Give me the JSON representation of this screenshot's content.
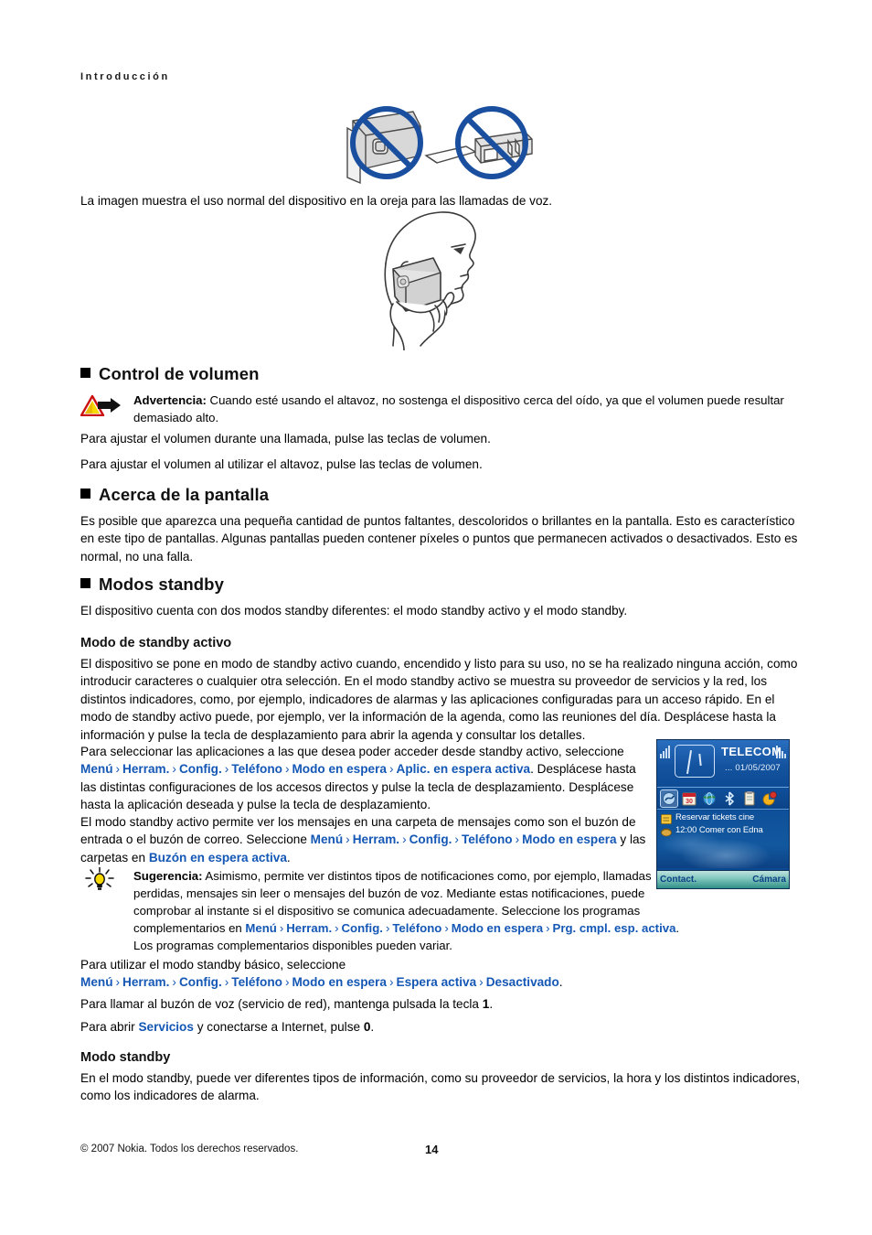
{
  "running_head": "Introducción",
  "figures": {
    "prohibition_caption": "La imagen muestra el uso normal del dispositivo en la oreja para las llamadas de voz.",
    "icon_no_touch_back": "prohibition-sign",
    "icon_no_touch_antenna": "prohibition-sign",
    "icon_head_phone": "head-with-phone-illustration"
  },
  "sections": {
    "volume": {
      "heading": "Control de volumen",
      "warning": {
        "label": "Advertencia:",
        "text": " Cuando esté usando el altavoz, no sostenga el dispositivo cerca del oído, ya que el volumen puede resultar demasiado alto.",
        "icon": "warning-triangle-icon"
      },
      "p1": "Para ajustar el volumen durante una llamada, pulse las teclas de volumen.",
      "p2": "Para ajustar el volumen al utilizar el altavoz, pulse las teclas de volumen."
    },
    "display": {
      "heading": "Acerca de la pantalla",
      "p1": "Es posible que aparezca una pequeña cantidad de puntos faltantes, descoloridos o brillantes en la pantalla. Esto es característico en este tipo de pantallas. Algunas pantallas pueden contener píxeles o puntos que permanecen activados o desactivados. Esto es normal, no una falla."
    },
    "standby": {
      "heading": "Modos standby",
      "intro": "El dispositivo cuenta con dos modos standby diferentes: el modo standby activo y el modo standby.",
      "active": {
        "heading": "Modo de standby activo",
        "p1": "El dispositivo se pone en modo de standby activo cuando, encendido y listo para su uso, no se ha realizado ninguna acción, como introducir caracteres o cualquier otra selección. En el modo standby activo se muestra su proveedor de servicios y la red, los distintos indicadores, como, por ejemplo, indicadores de alarmas y las aplicaciones configuradas para un acceso rápido. En el modo de standby activo puede, por ejemplo, ver la información de la agenda, como las reuniones del día. Desplácese hasta la información y pulse la tecla de desplazamiento para abrir la agenda y consultar los detalles.",
        "p2_pre": "Para seleccionar las aplicaciones a las que desea poder acceder desde standby activo, seleccione ",
        "p2_path": [
          "Menú",
          "Herram.",
          "Config.",
          "Teléfono",
          "Modo en espera",
          "Aplic. en espera activa"
        ],
        "p2_post": ". Desplácese hasta las distintas configuraciones de los accesos directos y pulse la tecla de desplazamiento. Desplácese hasta la aplicación deseada y pulse la tecla de desplazamiento.",
        "p3_pre": "El modo standby activo permite ver los mensajes en una carpeta de mensajes como son el buzón de entrada o el buzón de correo. Seleccione ",
        "p3_path": [
          "Menú",
          "Herram.",
          "Config.",
          "Teléfono",
          "Modo en espera"
        ],
        "p3_mid": " y las carpetas en ",
        "p3_link": "Buzón en espera activa",
        "p3_post": "."
      },
      "tip": {
        "icon": "lightbulb-tip-icon",
        "label": "Sugerencia:",
        "text": " Asimismo, permite ver distintos tipos de notificaciones como, por ejemplo, llamadas perdidas, mensajes sin leer o mensajes del buzón de voz. Mediante estas notificaciones, puede comprobar al instante si el dispositivo se comunica adecuadamente. Seleccione los programas complementarios en ",
        "path": [
          "Menú",
          "Herram.",
          "Config.",
          "Teléfono",
          "Modo en espera",
          "Prg. cmpl. esp. activa"
        ],
        "post": ". Los programas complementarios disponibles pueden variar."
      },
      "basic_pre": "Para utilizar el modo standby básico, seleccione ",
      "basic_path": [
        "Menú",
        "Herram.",
        "Config.",
        "Teléfono",
        "Modo en espera",
        "Espera activa",
        "Desactivado"
      ],
      "basic_post": ".",
      "voicemail_pre": "Para llamar al buzón de voz (servicio de red), mantenga pulsada la tecla ",
      "voicemail_key": "1",
      "voicemail_post": ".",
      "services_pre": "Para abrir ",
      "services_link": "Servicios",
      "services_mid": " y conectarse a Internet, pulse ",
      "services_key": "0",
      "services_post": ".",
      "basic_mode": {
        "heading": "Modo standby",
        "p1": "En el modo standby, puede ver diferentes tipos de información, como su proveedor de servicios, la hora y los distintos indicadores, como los indicadores de alarma."
      }
    }
  },
  "phone_screenshot": {
    "operator": "TELECOM",
    "date": "... 01/05/2007",
    "icons": [
      "connectivity-icon",
      "calendar-icon",
      "web-browser-icon",
      "bluetooth-icon",
      "notes-icon",
      "office-icon"
    ],
    "calendar_entries": [
      {
        "icon": "note-entry-icon",
        "text": "Reservar tickets cine"
      },
      {
        "icon": "meeting-entry-icon",
        "text": "12:00 Comer con Edna"
      }
    ],
    "softkey_left": "Contact.",
    "softkey_right": "Cámara"
  },
  "footer": {
    "copyright": "© 2007 Nokia. Todos los derechos reservados.",
    "page_number": "14"
  },
  "colors": {
    "link": "#1457b5",
    "phone_blue": "#0e5099",
    "warning_yellow": "#f7d900",
    "warning_red": "#cc1111"
  }
}
